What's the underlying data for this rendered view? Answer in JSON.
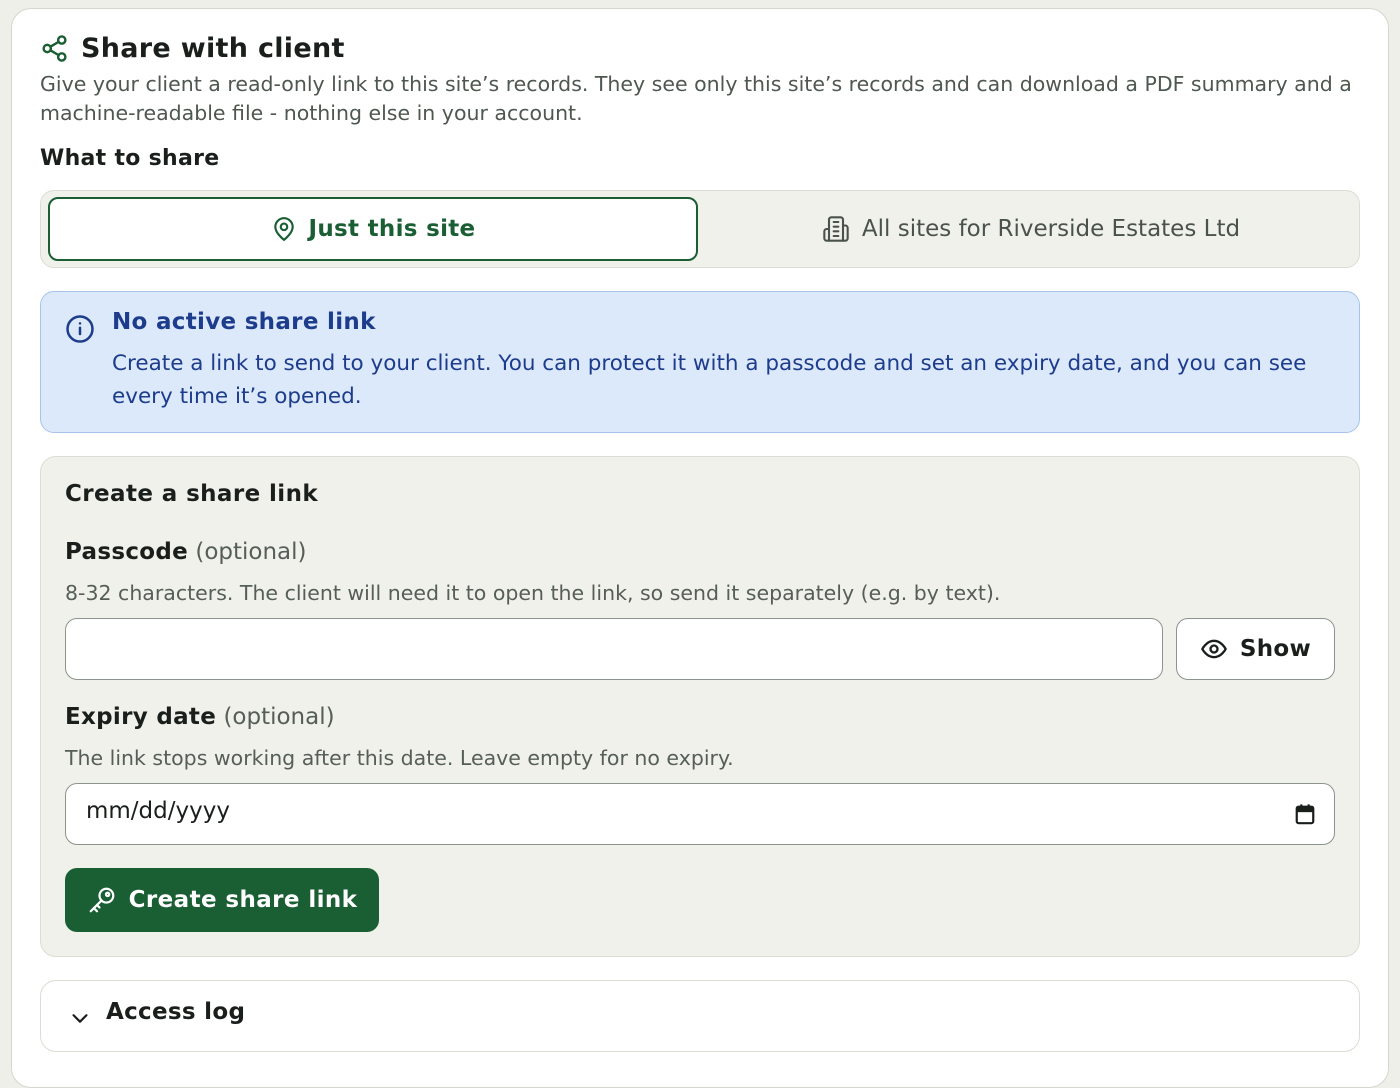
{
  "colors": {
    "accent": "#1a5e33",
    "info_bg": "#dce9fb",
    "info_text": "#1d3c8c",
    "panel_bg": "#f1f1ec"
  },
  "header": {
    "title": "Share with client",
    "title_icon": "share-icon",
    "intro": "Give your client a read-only link to this site’s records. They see only this site’s records and can download a PDF summary and a machine-readable file - nothing else in your account."
  },
  "scope": {
    "label": "What to share",
    "options": [
      {
        "label": "Just this site",
        "icon": "map-pin-icon",
        "selected": true
      },
      {
        "label": "All sites for Riverside Estates Ltd",
        "icon": "building-icon",
        "selected": false
      }
    ]
  },
  "notice": {
    "icon": "info-icon",
    "title": "No active share link",
    "body": "Create a link to send to your client. You can protect it with a passcode and set an expiry date, and you can see every time it’s opened."
  },
  "create": {
    "heading": "Create a share link",
    "passcode": {
      "label": "Passcode",
      "optional": "(optional)",
      "hint": "8-32 characters. The client will need it to open the link, so send it separately (e.g. by text).",
      "value": "",
      "show_label": "Show"
    },
    "expiry": {
      "label": "Expiry date",
      "optional": "(optional)",
      "hint": "The link stops working after this date. Leave empty for no expiry.",
      "placeholder": "mm/dd/yyyy"
    },
    "submit_label": "Create share link",
    "submit_icon": "key-icon"
  },
  "access_log": {
    "label": "Access log",
    "icon": "chevron-down-icon"
  }
}
